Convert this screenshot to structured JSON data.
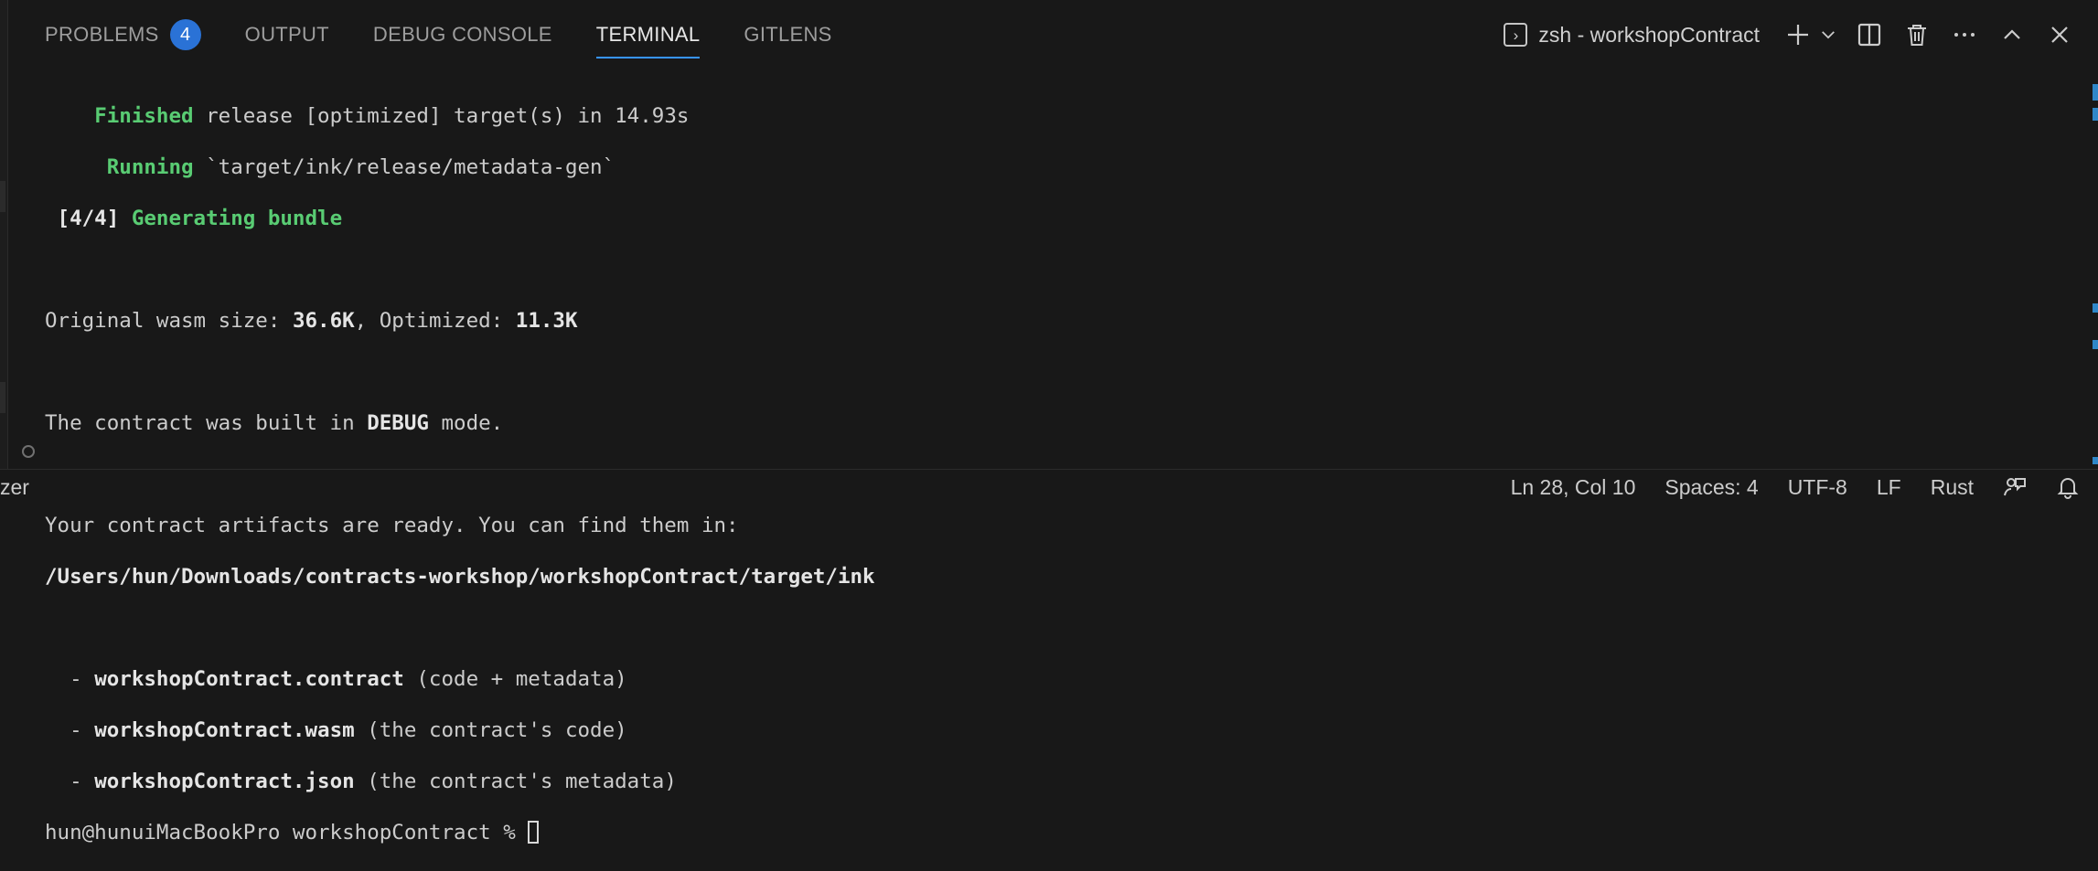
{
  "panel": {
    "tabs": [
      {
        "label": "PROBLEMS",
        "badge": "4"
      },
      {
        "label": "OUTPUT"
      },
      {
        "label": "DEBUG CONSOLE"
      },
      {
        "label": "TERMINAL",
        "active": true
      },
      {
        "label": "GITLENS"
      }
    ],
    "terminal_name": "zsh - workshopContract",
    "icons": [
      "terminal-icon",
      "plus-icon",
      "chevron-down-icon",
      "split-icon",
      "trash-icon",
      "more-icon",
      "chevron-up-icon",
      "close-icon"
    ]
  },
  "terminal": {
    "l1_keyword": "Finished",
    "l1_rest": " release [optimized] target(s) in 14.93s",
    "l2_keyword": "Running",
    "l2_rest": " `target/ink/release/metadata-gen`",
    "l3_step": "[4/4]",
    "l3_text": "Generating bundle",
    "l5_a": "Original wasm size: ",
    "l5_size": "36.6K",
    "l5_b": ", Optimized: ",
    "l5_opt": "11.3K",
    "l7_a": "The contract was built in ",
    "l7_mode": "DEBUG",
    "l7_b": " mode.",
    "l9": "Your contract artifacts are ready. You can find them in:",
    "l10": "/Users/hun/Downloads/contracts-workshop/workshopContract/target/ink",
    "artifacts": [
      {
        "name": "workshopContract.contract",
        "desc": " (code + metadata)"
      },
      {
        "name": "workshopContract.wasm",
        "desc": " (the contract's code)"
      },
      {
        "name": "workshopContract.json",
        "desc": " (the contract's metadata)"
      }
    ],
    "prompt": "hun@hunuiMacBookPro workshopContract % "
  },
  "status": {
    "left_text": "zer",
    "position": "Ln 28, Col 10",
    "spaces": "Spaces: 4",
    "encoding": "UTF-8",
    "eol": "LF",
    "language": "Rust"
  },
  "colors": {
    "background": "#181818",
    "accent": "#3794ff",
    "badge": "#2a72d6",
    "terminal_green": "#59cc73"
  }
}
